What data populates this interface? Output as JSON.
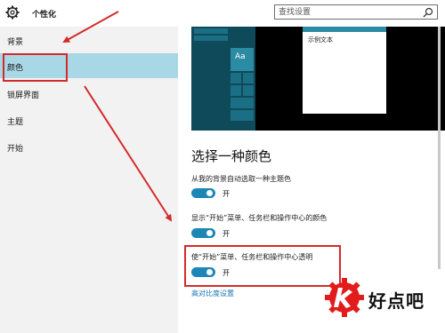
{
  "window": {
    "title": "个性化"
  },
  "search": {
    "placeholder": "查找设置"
  },
  "sidebar": {
    "items": [
      {
        "label": "背景"
      },
      {
        "label": "颜色"
      },
      {
        "label": "锁屏界面"
      },
      {
        "label": "主题"
      },
      {
        "label": "开始"
      }
    ],
    "active_index": 1
  },
  "preview": {
    "tile_label": "Aa",
    "sample_text": "示例文本"
  },
  "main": {
    "section_title": "选择一种颜色",
    "options": [
      {
        "label": "从我的背景自动选取一种主题色",
        "state": "开",
        "on": true
      },
      {
        "label": "显示“开始”菜单、任务栏和操作中心的颜色",
        "state": "开",
        "on": true
      },
      {
        "label": "使“开始”菜单、任务栏和操作中心透明",
        "state": "开",
        "on": true
      }
    ],
    "link": "高对比度设置"
  },
  "watermark": {
    "text": "好点吧"
  },
  "colors": {
    "accent": "#1a87b6",
    "highlight": "#d42a2a",
    "active_item": "#a8d7e6"
  }
}
